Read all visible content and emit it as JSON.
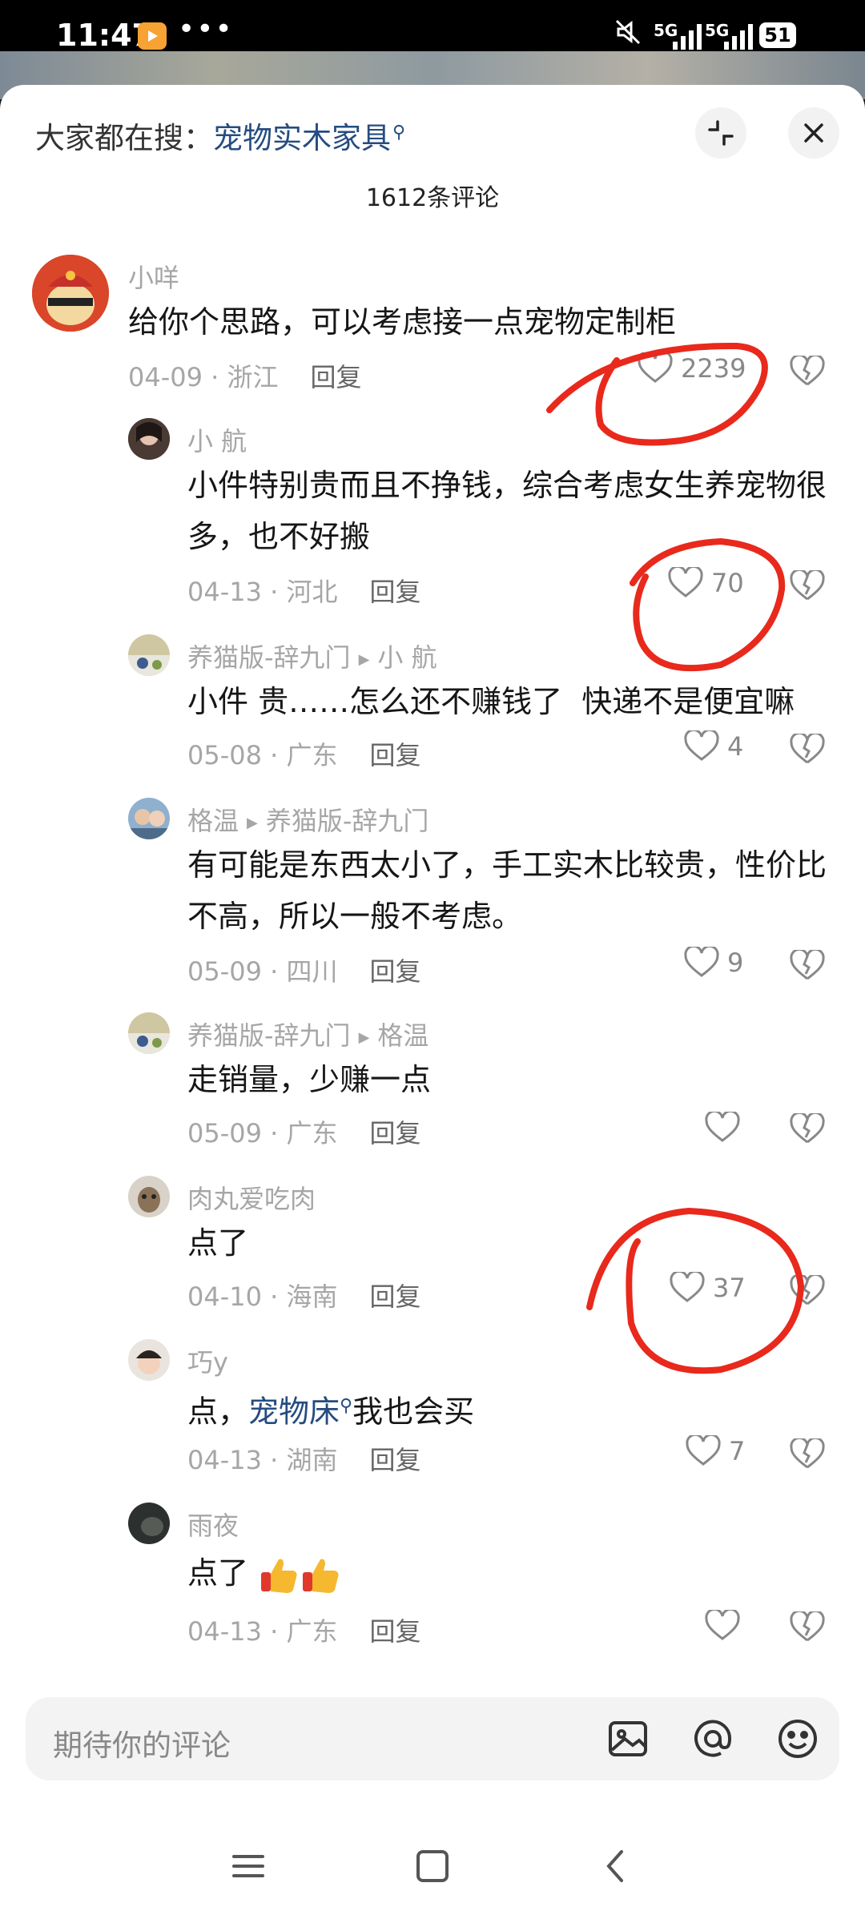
{
  "status_bar": {
    "time": "11:47",
    "dots": "•••",
    "sig1": "5G",
    "sig2": "5G",
    "battery": "51"
  },
  "header": {
    "search_prefix": "大家都在搜：",
    "search_keyword": "宠物实木家具",
    "comment_count": "1612条评论"
  },
  "comments": [
    {
      "user": "小咩",
      "text": "给你个思路，可以考虑接一点宠物定制柜",
      "date": "04-09 · 浙江",
      "reply": "回复",
      "likes": "2239"
    },
    {
      "user": "小 航",
      "text": "小件特别贵而且不挣钱，综合考虑女生养宠物很多，也不好搬",
      "date": "04-13 · 河北",
      "reply": "回复",
      "likes": "70"
    },
    {
      "user": "养猫版-辞九门",
      "to": "小 航",
      "text": "小件 贵……怎么还不赚钱了  快递不是便宜嘛",
      "date": "05-08 · 广东",
      "reply": "回复",
      "likes": "4"
    },
    {
      "user": "格温",
      "to": "养猫版-辞九门",
      "text": "有可能是东西太小了，手工实木比较贵，性价比不高，所以一般不考虑。",
      "date": "05-09 · 四川",
      "reply": "回复",
      "likes": "9"
    },
    {
      "user": "养猫版-辞九门",
      "to": "格温",
      "text": "走销量，少赚一点",
      "date": "05-09 · 广东",
      "reply": "回复",
      "likes": ""
    },
    {
      "user": "肉丸爱吃肉",
      "text": "点了",
      "date": "04-10 · 海南",
      "reply": "回复",
      "likes": "37"
    },
    {
      "user": "巧y",
      "text_prefix": "点，",
      "text_keyword": "宠物床",
      "text_suffix": "我也会买",
      "date": "04-13 · 湖南",
      "reply": "回复",
      "likes": "7"
    },
    {
      "user": "雨夜",
      "text": "点了",
      "date": "04-13 · 广东",
      "reply": "回复",
      "likes": ""
    }
  ],
  "input": {
    "placeholder": "期待你的评论"
  },
  "icons": {
    "collapse": "collapse-icon",
    "close": "close-icon",
    "like": "heart-icon",
    "dislike": "broken-heart-icon",
    "image": "image-icon",
    "mention": "at-icon",
    "emoji": "smiley-icon",
    "nav_menu": "recent-apps-icon",
    "nav_home": "home-icon",
    "nav_back": "back-icon"
  },
  "colors": {
    "keyword": "#254c80",
    "meta": "#a6a6a6",
    "annotation": "#e8291c"
  }
}
